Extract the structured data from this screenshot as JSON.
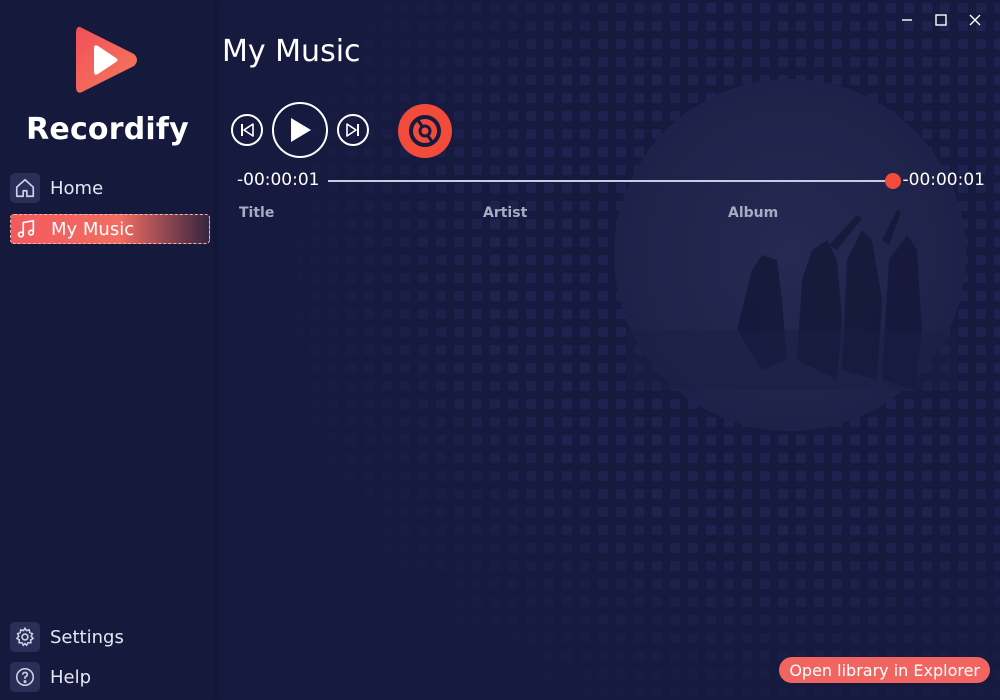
{
  "app": {
    "name": "Recordify",
    "accent_color": "#f24b3a"
  },
  "sidebar": {
    "items": [
      {
        "label": "Home",
        "icon": "home-icon"
      },
      {
        "label": "My Music",
        "icon": "music-note-icon",
        "active": true
      }
    ],
    "bottom_items": [
      {
        "label": "Settings",
        "icon": "gear-icon"
      },
      {
        "label": "Help",
        "icon": "help-icon"
      }
    ]
  },
  "page": {
    "title": "My Music"
  },
  "player": {
    "elapsed": "-00:00:01",
    "remaining": "-00:00:01",
    "progress": 1.0
  },
  "table": {
    "columns": [
      "Title",
      "Artist",
      "Album"
    ]
  },
  "footer": {
    "open_library_label": "Open library in Explorer"
  }
}
